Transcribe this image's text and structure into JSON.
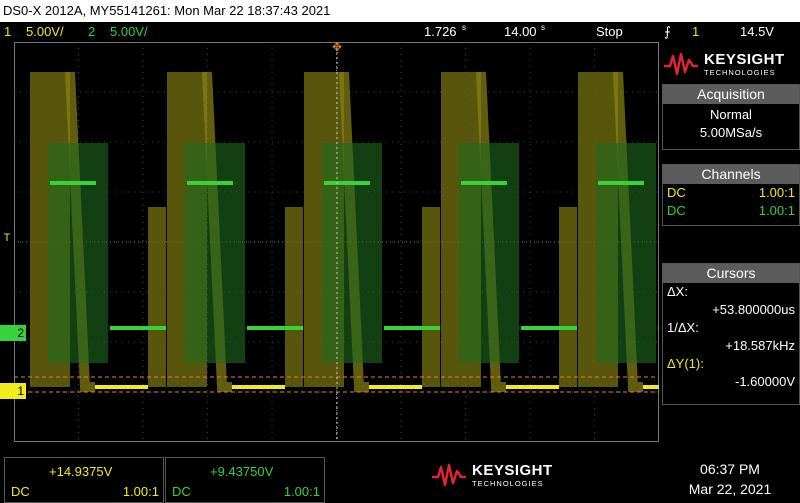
{
  "titlebar": {
    "text": "DS0-X 2012A, MY55141261: Mon Mar 22 18:37:43 2021"
  },
  "status": {
    "ch1_num": "1",
    "ch1_scale": "5.00V/",
    "ch2_num": "2",
    "ch2_scale": "5.00V/",
    "time_delay": "1.726",
    "time_scale": "14.00",
    "run_state": "Stop",
    "trig_source": "1",
    "trig_level": "14.5V"
  },
  "brand": {
    "name": "KEYSIGHT",
    "sub": "TECHNOLOGIES"
  },
  "acquisition": {
    "header": "Acquisition",
    "mode": "Normal",
    "rate": "5.00MSa/s"
  },
  "channels": {
    "header": "Channels",
    "rows": [
      {
        "coupling": "DC",
        "probe": "1.00:1",
        "color": "#f1ec1c"
      },
      {
        "coupling": "DC",
        "probe": "1.00:1",
        "color": "#36d33a"
      }
    ]
  },
  "cursors": {
    "header": "Cursors",
    "dx_label": "ΔX:",
    "dx_value": "+53.800000us",
    "inv_label": "1/ΔX:",
    "inv_value": "+18.587kHz",
    "dy_label": "ΔY(1):",
    "dy_value": "-1.60000V"
  },
  "bottom": {
    "ch1_value": "+14.9375V",
    "ch1_coupling": "DC",
    "ch1_probe": "1.00:1",
    "ch2_value": "+9.43750V",
    "ch2_coupling": "DC",
    "ch2_probe": "1.00:1",
    "brand": "KEYSIGHT",
    "brand_sub": "TECHNOLOGIES",
    "time": "06:37 PM",
    "date": "Mar 22, 2021"
  },
  "markers": {
    "ch1": "1",
    "ch2": "2",
    "trigger": "T"
  },
  "colors": {
    "ch1": "#f1ec1c",
    "ch2": "#36d33a",
    "brand_red": "#e0262f"
  }
}
